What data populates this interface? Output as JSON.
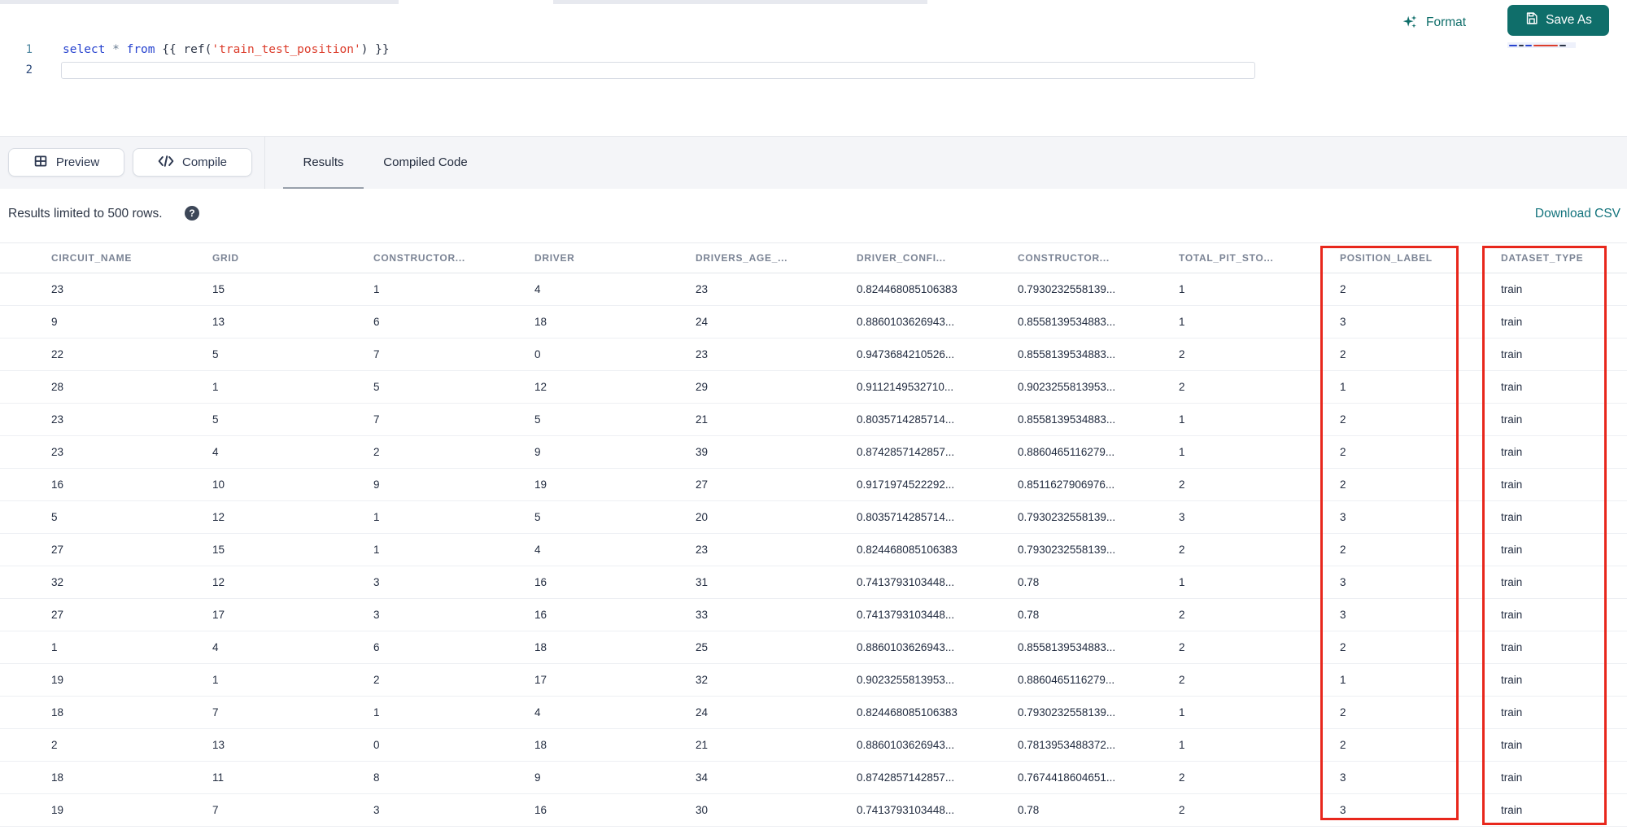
{
  "colors": {
    "accent_teal": "#0f6e6a",
    "link_teal": "#12737c",
    "highlight_red": "#e8271c",
    "toolbar_gray": "#f4f5f8"
  },
  "top_actions": {
    "format_label": "Format",
    "save_as_label": "Save As"
  },
  "editor": {
    "line1_number": "1",
    "line2_number": "2",
    "code": {
      "kw_select": "select",
      "star": "*",
      "kw_from": "from",
      "open_braces": "{{ ",
      "fn_ref": "ref(",
      "string": "'train_test_position'",
      "close_paren": ")",
      "close_braces": " }}"
    }
  },
  "toolbar": {
    "preview_label": "Preview",
    "compile_label": "Compile",
    "tabs": [
      {
        "label": "Results",
        "active": true
      },
      {
        "label": "Compiled Code",
        "active": false
      }
    ]
  },
  "results_meta": {
    "limit_text": "Results limited to 500 rows.",
    "help_icon": "?",
    "download_label": "Download CSV"
  },
  "table": {
    "headers": [
      "CIRCUIT_NAME",
      "GRID",
      "CONSTRUCTOR...",
      "DRIVER",
      "DRIVERS_AGE_...",
      "DRIVER_CONFI...",
      "CONSTRUCTOR...",
      "TOTAL_PIT_STO...",
      "POSITION_LABEL",
      "DATASET_TYPE"
    ],
    "rows": [
      [
        "23",
        "15",
        "1",
        "4",
        "23",
        "0.824468085106383",
        "0.7930232558139...",
        "1",
        "2",
        "train"
      ],
      [
        "9",
        "13",
        "6",
        "18",
        "24",
        "0.8860103626943...",
        "0.8558139534883...",
        "1",
        "3",
        "train"
      ],
      [
        "22",
        "5",
        "7",
        "0",
        "23",
        "0.9473684210526...",
        "0.8558139534883...",
        "2",
        "2",
        "train"
      ],
      [
        "28",
        "1",
        "5",
        "12",
        "29",
        "0.9112149532710...",
        "0.9023255813953...",
        "2",
        "1",
        "train"
      ],
      [
        "23",
        "5",
        "7",
        "5",
        "21",
        "0.8035714285714...",
        "0.8558139534883...",
        "1",
        "2",
        "train"
      ],
      [
        "23",
        "4",
        "2",
        "9",
        "39",
        "0.8742857142857...",
        "0.8860465116279...",
        "1",
        "2",
        "train"
      ],
      [
        "16",
        "10",
        "9",
        "19",
        "27",
        "0.9171974522292...",
        "0.8511627906976...",
        "2",
        "2",
        "train"
      ],
      [
        "5",
        "12",
        "1",
        "5",
        "20",
        "0.8035714285714...",
        "0.7930232558139...",
        "3",
        "3",
        "train"
      ],
      [
        "27",
        "15",
        "1",
        "4",
        "23",
        "0.824468085106383",
        "0.7930232558139...",
        "2",
        "2",
        "train"
      ],
      [
        "32",
        "12",
        "3",
        "16",
        "31",
        "0.7413793103448...",
        "0.78",
        "1",
        "3",
        "train"
      ],
      [
        "27",
        "17",
        "3",
        "16",
        "33",
        "0.7413793103448...",
        "0.78",
        "2",
        "3",
        "train"
      ],
      [
        "1",
        "4",
        "6",
        "18",
        "25",
        "0.8860103626943...",
        "0.8558139534883...",
        "2",
        "2",
        "train"
      ],
      [
        "19",
        "1",
        "2",
        "17",
        "32",
        "0.9023255813953...",
        "0.8860465116279...",
        "2",
        "1",
        "train"
      ],
      [
        "18",
        "7",
        "1",
        "4",
        "24",
        "0.824468085106383",
        "0.7930232558139...",
        "1",
        "2",
        "train"
      ],
      [
        "2",
        "13",
        "0",
        "18",
        "21",
        "0.8860103626943...",
        "0.7813953488372...",
        "1",
        "2",
        "train"
      ],
      [
        "18",
        "11",
        "8",
        "9",
        "34",
        "0.8742857142857...",
        "0.7674418604651...",
        "2",
        "3",
        "train"
      ],
      [
        "19",
        "7",
        "3",
        "16",
        "30",
        "0.7413793103448...",
        "0.78",
        "2",
        "3",
        "train"
      ]
    ]
  },
  "annotations": {
    "highlighted_columns": [
      "POSITION_LABEL",
      "DATASET_TYPE"
    ]
  }
}
